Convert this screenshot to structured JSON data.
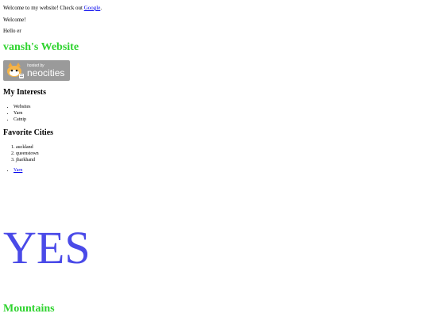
{
  "intro": {
    "welcome_text": "Welcome to my website! Check out ",
    "google_link": "Google",
    "period": ".",
    "welcome_short": "Welcome!",
    "hello": "Hello er"
  },
  "site_title": "vansh's Website",
  "badge": {
    "hosted_by": "hosted by",
    "brand": "neocities"
  },
  "interests": {
    "heading": "My Interests",
    "items": [
      "Websites",
      "Yarn",
      "Catnip"
    ]
  },
  "cities": {
    "heading": "Favorite Cities",
    "items": [
      "auckland",
      "queenstown",
      "jharkhand"
    ]
  },
  "yarn_link": "Yarn",
  "big_text": "YES",
  "mountains_heading": "Mountains",
  "colors": {
    "heading_green": "#2fd32f",
    "link_blue": "#0000ee",
    "yes_blue": "#4a4ae8",
    "badge_gray": "#9a9a9a"
  }
}
